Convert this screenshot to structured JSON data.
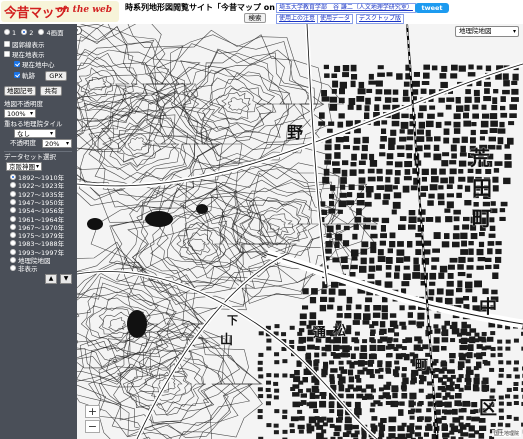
{
  "header": {
    "logo_jp": "今昔マップ",
    "logo_en": "on the web",
    "site_title": "時系列地形図閲覧サイト「今昔マップ on the web」",
    "search_label": "検索",
    "credit": "埼玉大学教育学部　谷 謙二（人文地理学研究室）",
    "link_usage": "使用上の注意",
    "link_data": "使用データ",
    "link_desktop": "デスクトップ版",
    "tweet_label": "tweet"
  },
  "sidebar": {
    "screen_1": "1",
    "screen_2": "2",
    "screen_4": "4画面",
    "boundary": "図郭線表示",
    "current_pos": "現在地表示",
    "center": "現在地中心",
    "track": "軌跡",
    "gpx": "GPX",
    "bookmark": "地図記号",
    "share": "共有",
    "map_opacity_label": "地図不透明度",
    "map_opacity_value": "100%",
    "overlay_label": "重ねる地理院タイル",
    "overlay_value": "なし",
    "overlay_opacity_label": "不透明度",
    "overlay_opacity_value": "20%",
    "dataset_label": "データセット選択",
    "dataset_value": "京阪神圏",
    "periods": [
      "1892〜1910年",
      "1922〜1923年",
      "1927〜1935年",
      "1947〜1950年",
      "1954〜1956年",
      "1961〜1964年",
      "1967〜1970年",
      "1975〜1979年",
      "1983〜1988年",
      "1993〜1997年",
      "地理院地図",
      "非表示"
    ],
    "up": "▲",
    "down": "▼"
  },
  "map": {
    "basemap_select": "地理院地図",
    "labels": [
      "荒",
      "田",
      "町",
      "中",
      "野",
      "山",
      "区",
      "通",
      "松",
      "下",
      "町"
    ],
    "zoom_in": "+",
    "zoom_out": "−",
    "attribution": "国土地理院"
  }
}
